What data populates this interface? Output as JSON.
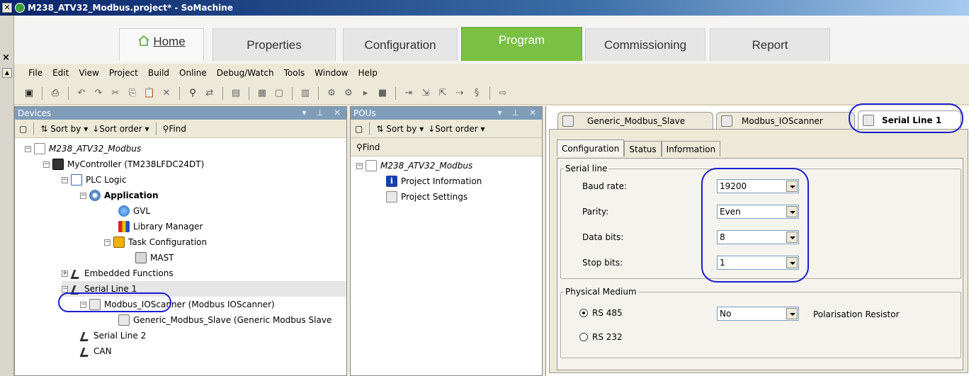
{
  "window": {
    "title": "M238_ATV32_Modbus.project* - SoMachine"
  },
  "ribbon": {
    "tabs": [
      {
        "label": "Home"
      },
      {
        "label": "Properties"
      },
      {
        "label": "Configuration"
      },
      {
        "label": "Program"
      },
      {
        "label": "Commissioning"
      },
      {
        "label": "Report"
      }
    ]
  },
  "menu": {
    "items": [
      "File",
      "Edit",
      "View",
      "Project",
      "Build",
      "Online",
      "Debug/Watch",
      "Tools",
      "Window",
      "Help"
    ]
  },
  "devices_panel": {
    "title": "Devices",
    "sort_by": "Sort by",
    "sort_order": "Sort order",
    "find": "Find",
    "tree": {
      "root": "M238_ATV32_Modbus",
      "controller": "MyController (TM238LFDC24DT)",
      "plc_logic": "PLC Logic",
      "application": "Application",
      "gvl": "GVL",
      "library_manager": "Library Manager",
      "task_configuration": "Task Configuration",
      "mast": "MAST",
      "embedded_functions": "Embedded Functions",
      "serial_line_1": "Serial Line 1",
      "modbus_ioscanner": "Modbus_IOScanner (Modbus IOScanner)",
      "generic_slave": "Generic_Modbus_Slave (Generic Modbus Slave",
      "serial_line_2": "Serial Line 2",
      "can": "CAN"
    }
  },
  "pous_panel": {
    "title": "POUs",
    "sort_by": "Sort by",
    "sort_order": "Sort order",
    "find": "Find",
    "tree": {
      "root": "M238_ATV32_Modbus",
      "project_information": "Project Information",
      "project_settings": "Project Settings"
    }
  },
  "editor": {
    "tabs": [
      {
        "label": "Generic_Modbus_Slave"
      },
      {
        "label": "Modbus_IOScanner"
      },
      {
        "label": "Serial Line 1"
      }
    ],
    "sub_tabs": [
      "Configuration",
      "Status",
      "Information"
    ],
    "serial_line": {
      "group_label": "Serial line",
      "baud_rate_label": "Baud rate:",
      "baud_rate": "19200",
      "parity_label": "Parity:",
      "parity": "Even",
      "data_bits_label": "Data bits:",
      "data_bits": "8",
      "stop_bits_label": "Stop bits:",
      "stop_bits": "1"
    },
    "physical_medium": {
      "group_label": "Physical Medium",
      "rs485": "RS 485",
      "rs232": "RS 232",
      "selected": "RS 485",
      "polarisation_value": "No",
      "polarisation_label": "Polarisation Resistor"
    }
  },
  "colors": {
    "program_tab": "#7ac143",
    "highlight_circle": "#1c1cd0",
    "panel_header": "#7f9db9"
  }
}
